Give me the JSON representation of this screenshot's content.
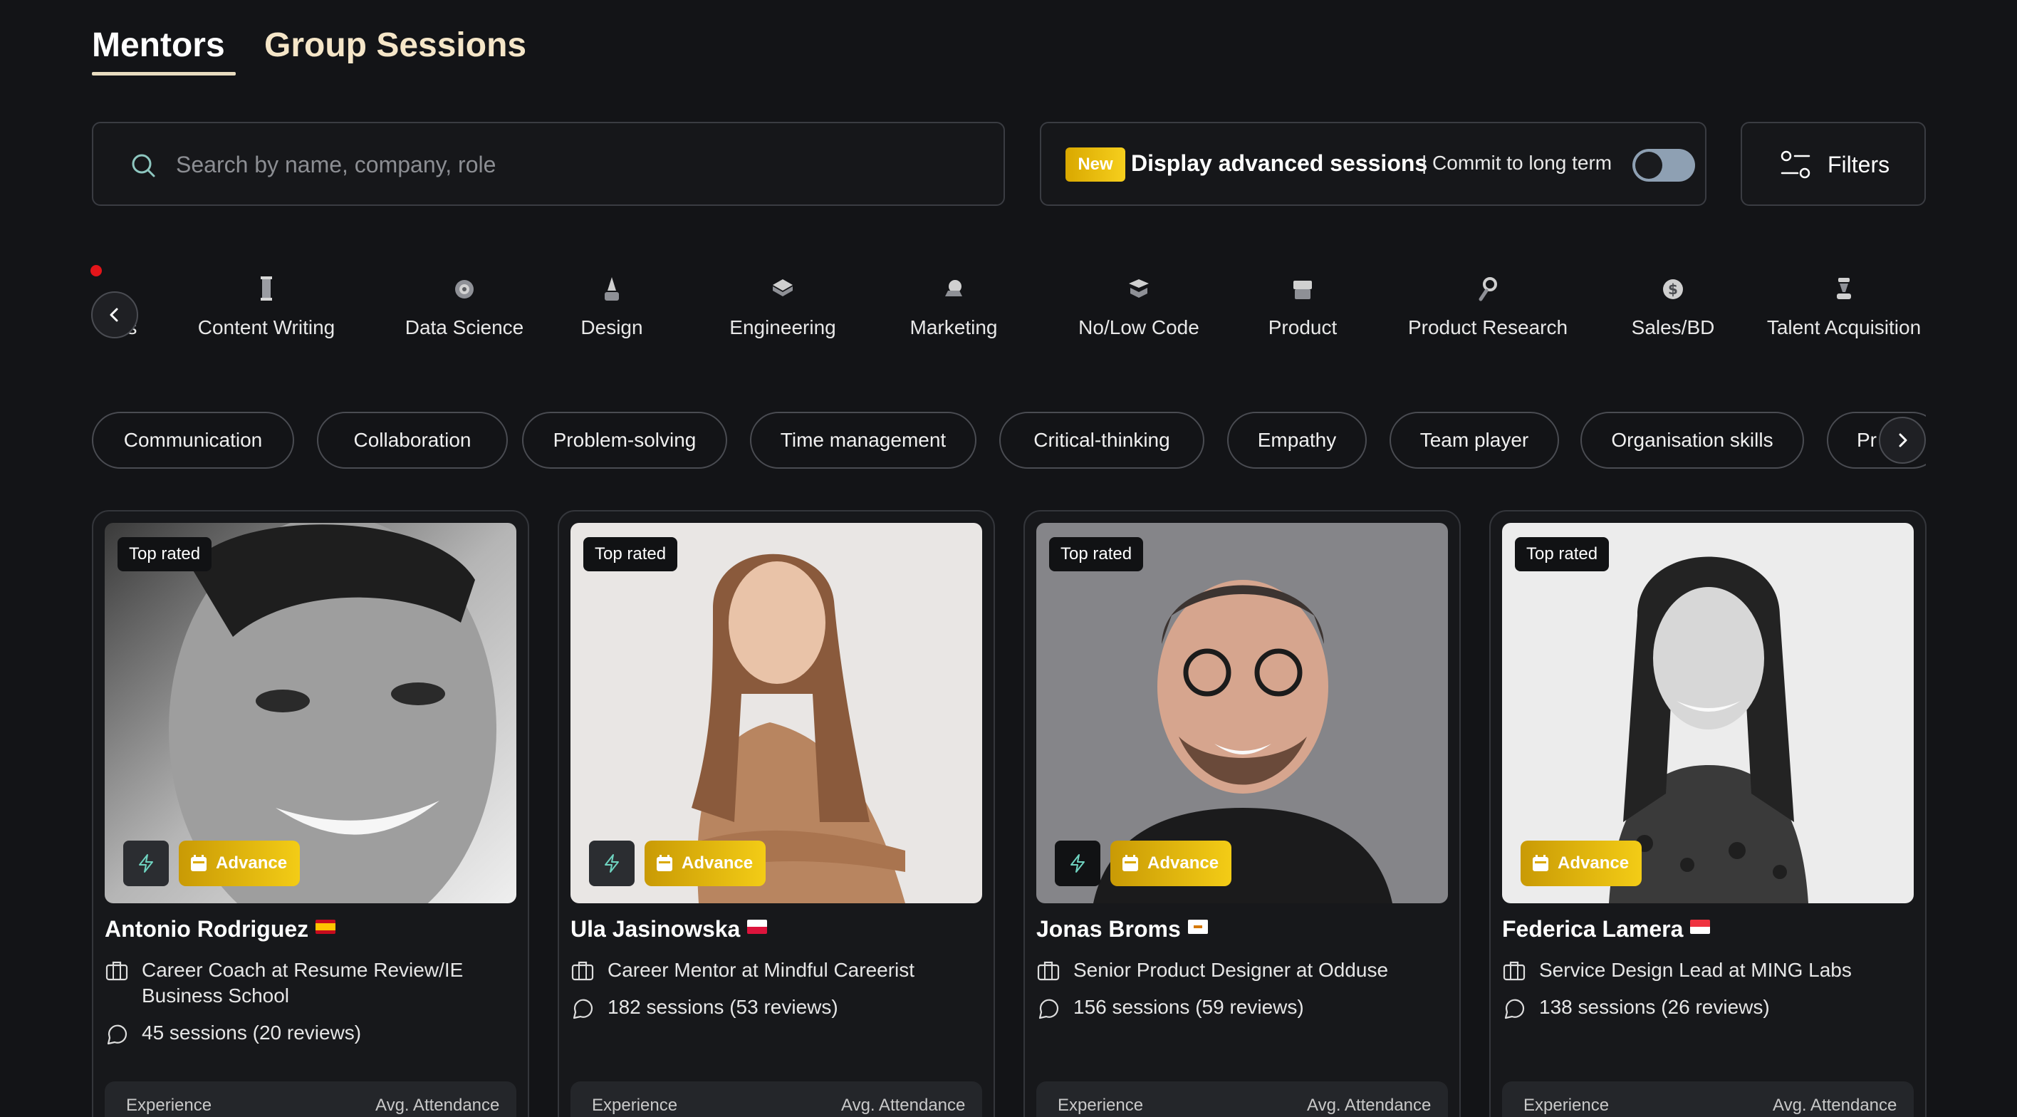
{
  "tabs": [
    {
      "label": "Mentors",
      "active": true
    },
    {
      "label": "Group Sessions",
      "active": false
    }
  ],
  "search": {
    "placeholder": "Search by name, company, role"
  },
  "advanced": {
    "badge": "New",
    "title": "Display advanced sessions",
    "subtitle": "| Commit to long term",
    "toggle_on": false
  },
  "filters": {
    "label": "Filters"
  },
  "categories": [
    {
      "label": "kills",
      "icon": "partial-icon"
    },
    {
      "label": "Content Writing",
      "icon": "pen-icon"
    },
    {
      "label": "Data Science",
      "icon": "chart-icon"
    },
    {
      "label": "Design",
      "icon": "design-icon"
    },
    {
      "label": "Engineering",
      "icon": "code-icon"
    },
    {
      "label": "Marketing",
      "icon": "megaphone-icon"
    },
    {
      "label": "No/Low Code",
      "icon": "blocks-icon"
    },
    {
      "label": "Product",
      "icon": "box-icon"
    },
    {
      "label": "Product Research",
      "icon": "magnifier-icon"
    },
    {
      "label": "Sales/BD",
      "icon": "dollar-icon"
    },
    {
      "label": "Talent Acquisition",
      "icon": "people-icon"
    }
  ],
  "skills": [
    "Communication",
    "Collaboration",
    "Problem-solving",
    "Time management",
    "Critical-thinking",
    "Empathy",
    "Team player",
    "Organisation skills",
    "Pr"
  ],
  "cards": [
    {
      "badge": "Top rated",
      "advance_label": "Advance",
      "name": "Antonio Rodriguez",
      "flag": "spain",
      "role_line1": "Career Coach at Resume Review/IE",
      "role_line2": "Business School",
      "sessions": "45 sessions (20 reviews)",
      "stat_left": "Experience",
      "stat_right": "Avg. Attendance"
    },
    {
      "badge": "Top rated",
      "advance_label": "Advance",
      "name": "Ula Jasinowska",
      "flag": "poland",
      "role_line1": "Career Mentor at Mindful Careerist",
      "role_line2": "",
      "sessions": "182 sessions (53 reviews)",
      "stat_left": "Experience",
      "stat_right": "Avg. Attendance"
    },
    {
      "badge": "Top rated",
      "advance_label": "Advance",
      "name": "Jonas Broms",
      "flag": "cyprus",
      "role_line1": "Senior Product Designer at Odduse",
      "role_line2": "",
      "sessions": "156 sessions (59 reviews)",
      "stat_left": "Experience",
      "stat_right": "Avg. Attendance"
    },
    {
      "badge": "Top rated",
      "advance_label": "Advance",
      "name": "Federica Lamera",
      "flag": "singapore",
      "role_line1": "Service Design Lead at MING Labs",
      "role_line2": "",
      "sessions": "138 sessions (26 reviews)",
      "stat_left": "Experience",
      "stat_right": "Avg. Attendance"
    }
  ],
  "colors": {
    "background": "#131417",
    "accent": "#f3cc16",
    "tab_underline": "#e8dcc0"
  }
}
